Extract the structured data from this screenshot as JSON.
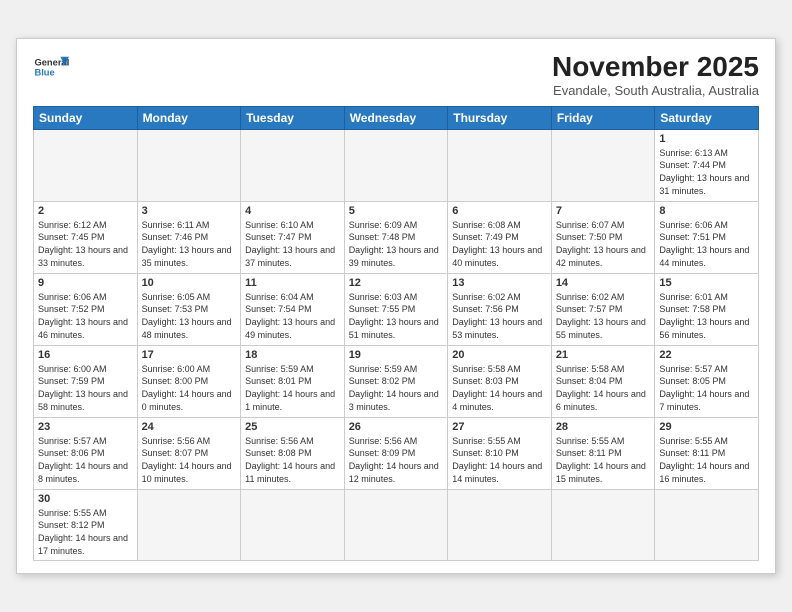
{
  "header": {
    "logo_line1": "General",
    "logo_line2": "Blue",
    "month": "November 2025",
    "location": "Evandale, South Australia, Australia"
  },
  "weekdays": [
    "Sunday",
    "Monday",
    "Tuesday",
    "Wednesday",
    "Thursday",
    "Friday",
    "Saturday"
  ],
  "weeks": [
    [
      {
        "day": "",
        "empty": true
      },
      {
        "day": "",
        "empty": true
      },
      {
        "day": "",
        "empty": true
      },
      {
        "day": "",
        "empty": true
      },
      {
        "day": "",
        "empty": true
      },
      {
        "day": "",
        "empty": true
      },
      {
        "day": "1",
        "sunrise": "6:13 AM",
        "sunset": "7:44 PM",
        "daylight": "13 hours and 31 minutes."
      }
    ],
    [
      {
        "day": "2",
        "sunrise": "6:12 AM",
        "sunset": "7:45 PM",
        "daylight": "13 hours and 33 minutes."
      },
      {
        "day": "3",
        "sunrise": "6:11 AM",
        "sunset": "7:46 PM",
        "daylight": "13 hours and 35 minutes."
      },
      {
        "day": "4",
        "sunrise": "6:10 AM",
        "sunset": "7:47 PM",
        "daylight": "13 hours and 37 minutes."
      },
      {
        "day": "5",
        "sunrise": "6:09 AM",
        "sunset": "7:48 PM",
        "daylight": "13 hours and 39 minutes."
      },
      {
        "day": "6",
        "sunrise": "6:08 AM",
        "sunset": "7:49 PM",
        "daylight": "13 hours and 40 minutes."
      },
      {
        "day": "7",
        "sunrise": "6:07 AM",
        "sunset": "7:50 PM",
        "daylight": "13 hours and 42 minutes."
      },
      {
        "day": "8",
        "sunrise": "6:06 AM",
        "sunset": "7:51 PM",
        "daylight": "13 hours and 44 minutes."
      }
    ],
    [
      {
        "day": "9",
        "sunrise": "6:06 AM",
        "sunset": "7:52 PM",
        "daylight": "13 hours and 46 minutes."
      },
      {
        "day": "10",
        "sunrise": "6:05 AM",
        "sunset": "7:53 PM",
        "daylight": "13 hours and 48 minutes."
      },
      {
        "day": "11",
        "sunrise": "6:04 AM",
        "sunset": "7:54 PM",
        "daylight": "13 hours and 49 minutes."
      },
      {
        "day": "12",
        "sunrise": "6:03 AM",
        "sunset": "7:55 PM",
        "daylight": "13 hours and 51 minutes."
      },
      {
        "day": "13",
        "sunrise": "6:02 AM",
        "sunset": "7:56 PM",
        "daylight": "13 hours and 53 minutes."
      },
      {
        "day": "14",
        "sunrise": "6:02 AM",
        "sunset": "7:57 PM",
        "daylight": "13 hours and 55 minutes."
      },
      {
        "day": "15",
        "sunrise": "6:01 AM",
        "sunset": "7:58 PM",
        "daylight": "13 hours and 56 minutes."
      }
    ],
    [
      {
        "day": "16",
        "sunrise": "6:00 AM",
        "sunset": "7:59 PM",
        "daylight": "13 hours and 58 minutes."
      },
      {
        "day": "17",
        "sunrise": "6:00 AM",
        "sunset": "8:00 PM",
        "daylight": "14 hours and 0 minutes."
      },
      {
        "day": "18",
        "sunrise": "5:59 AM",
        "sunset": "8:01 PM",
        "daylight": "14 hours and 1 minute."
      },
      {
        "day": "19",
        "sunrise": "5:59 AM",
        "sunset": "8:02 PM",
        "daylight": "14 hours and 3 minutes."
      },
      {
        "day": "20",
        "sunrise": "5:58 AM",
        "sunset": "8:03 PM",
        "daylight": "14 hours and 4 minutes."
      },
      {
        "day": "21",
        "sunrise": "5:58 AM",
        "sunset": "8:04 PM",
        "daylight": "14 hours and 6 minutes."
      },
      {
        "day": "22",
        "sunrise": "5:57 AM",
        "sunset": "8:05 PM",
        "daylight": "14 hours and 7 minutes."
      }
    ],
    [
      {
        "day": "23",
        "sunrise": "5:57 AM",
        "sunset": "8:06 PM",
        "daylight": "14 hours and 8 minutes."
      },
      {
        "day": "24",
        "sunrise": "5:56 AM",
        "sunset": "8:07 PM",
        "daylight": "14 hours and 10 minutes."
      },
      {
        "day": "25",
        "sunrise": "5:56 AM",
        "sunset": "8:08 PM",
        "daylight": "14 hours and 11 minutes."
      },
      {
        "day": "26",
        "sunrise": "5:56 AM",
        "sunset": "8:09 PM",
        "daylight": "14 hours and 12 minutes."
      },
      {
        "day": "27",
        "sunrise": "5:55 AM",
        "sunset": "8:10 PM",
        "daylight": "14 hours and 14 minutes."
      },
      {
        "day": "28",
        "sunrise": "5:55 AM",
        "sunset": "8:11 PM",
        "daylight": "14 hours and 15 minutes."
      },
      {
        "day": "29",
        "sunrise": "5:55 AM",
        "sunset": "8:11 PM",
        "daylight": "14 hours and 16 minutes."
      }
    ],
    [
      {
        "day": "30",
        "sunrise": "5:55 AM",
        "sunset": "8:12 PM",
        "daylight": "14 hours and 17 minutes."
      },
      {
        "day": "",
        "empty": true
      },
      {
        "day": "",
        "empty": true
      },
      {
        "day": "",
        "empty": true
      },
      {
        "day": "",
        "empty": true
      },
      {
        "day": "",
        "empty": true
      },
      {
        "day": "",
        "empty": true
      }
    ]
  ]
}
